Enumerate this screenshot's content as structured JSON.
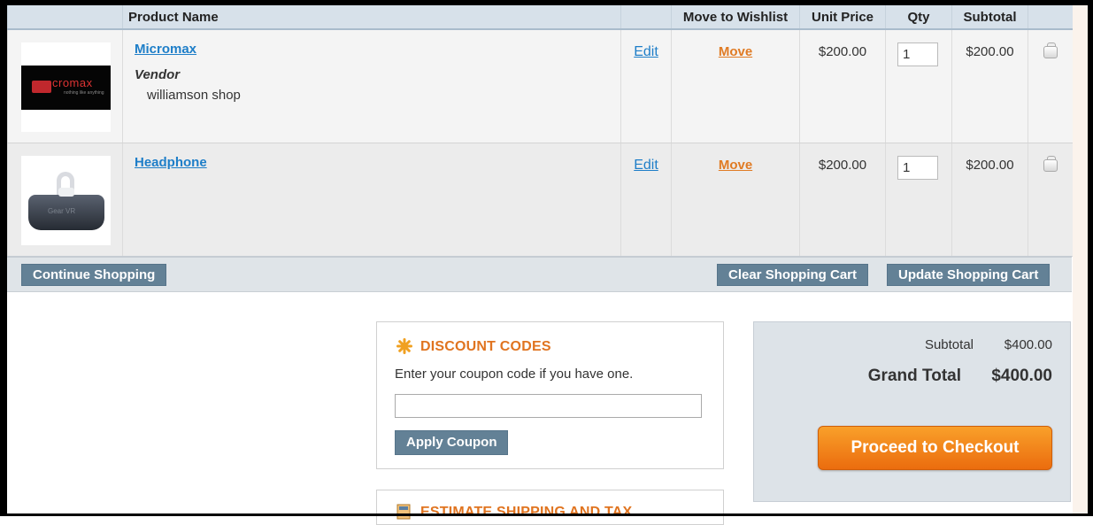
{
  "table": {
    "headers": {
      "product_name": "Product Name",
      "move_to_wishlist": "Move to Wishlist",
      "unit_price": "Unit Price",
      "qty": "Qty",
      "subtotal": "Subtotal"
    },
    "items": [
      {
        "name": "Micromax",
        "image_text": "cromax",
        "image_subtext": "nothing like anything",
        "vendor_label": "Vendor",
        "vendor_value": "williamson shop",
        "edit": "Edit",
        "move": "Move",
        "unit_price": "$200.00",
        "qty": "1",
        "subtotal": "$200.00"
      },
      {
        "name": "Headphone",
        "image_text": "Gear VR",
        "edit": "Edit",
        "move": "Move",
        "unit_price": "$200.00",
        "qty": "1",
        "subtotal": "$200.00"
      }
    ]
  },
  "actions": {
    "continue_shopping": "Continue Shopping",
    "clear_cart": "Clear Shopping Cart",
    "update_cart": "Update Shopping Cart"
  },
  "discount": {
    "title": "DISCOUNT CODES",
    "text": "Enter your coupon code if you have one.",
    "coupon_value": "",
    "apply": "Apply Coupon"
  },
  "shipping": {
    "title": "ESTIMATE SHIPPING AND TAX"
  },
  "totals": {
    "subtotal_label": "Subtotal",
    "subtotal_value": "$400.00",
    "grand_total_label": "Grand Total",
    "grand_total_value": "$400.00",
    "checkout": "Proceed to Checkout"
  },
  "colors": {
    "link": "#1e7ec8",
    "accent_orange": "#e07420",
    "button": "#638196",
    "header_bg": "#d7e1ea"
  }
}
